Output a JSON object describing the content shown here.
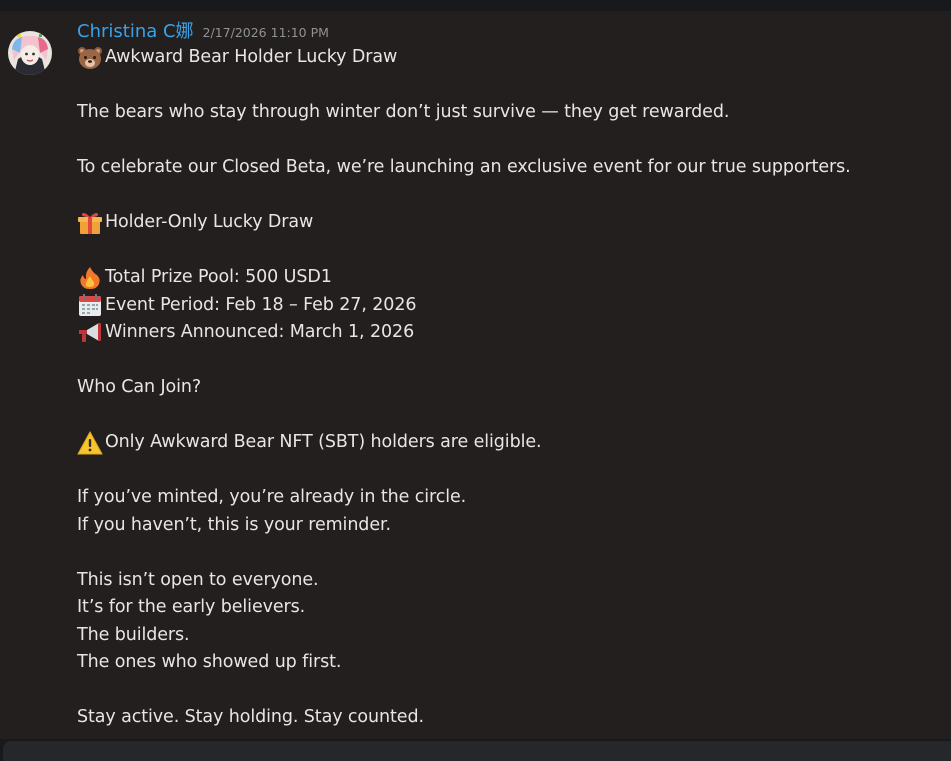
{
  "message": {
    "author": "Christina C娜",
    "timestamp": "2/17/2026 11:10 PM",
    "author_color": "#3aa3e8",
    "lines": {
      "l1": "Awkward Bear Holder Lucky Draw",
      "l2": "The bears who stay through winter don’t just survive — they get rewarded.",
      "l3": "To celebrate our Closed Beta, we’re launching an exclusive event for our true supporters.",
      "l4": "Holder-Only Lucky Draw",
      "l5": "Total Prize Pool: 500 USD1",
      "l6": "Event Period: Feb 18 – Feb 27, 2026",
      "l7": "Winners Announced: March 1, 2026",
      "l8": "Who Can Join?",
      "l9": "Only Awkward Bear NFT (SBT) holders are eligible.",
      "l10": "If you’ve minted, you’re already in the circle.",
      "l11": "If you haven’t, this is your reminder.",
      "l12": "This isn’t open to everyone.",
      "l13": "It’s for the early believers.",
      "l14": "The builders.",
      "l15": "The ones who showed up first.",
      "l16": "Stay active. Stay holding. Stay counted."
    },
    "emojis": {
      "l1": "bear-face-icon",
      "l4": "gift-icon",
      "l5": "fire-icon",
      "l6": "calendar-icon",
      "l7": "megaphone-icon",
      "l9": "warning-icon"
    }
  }
}
